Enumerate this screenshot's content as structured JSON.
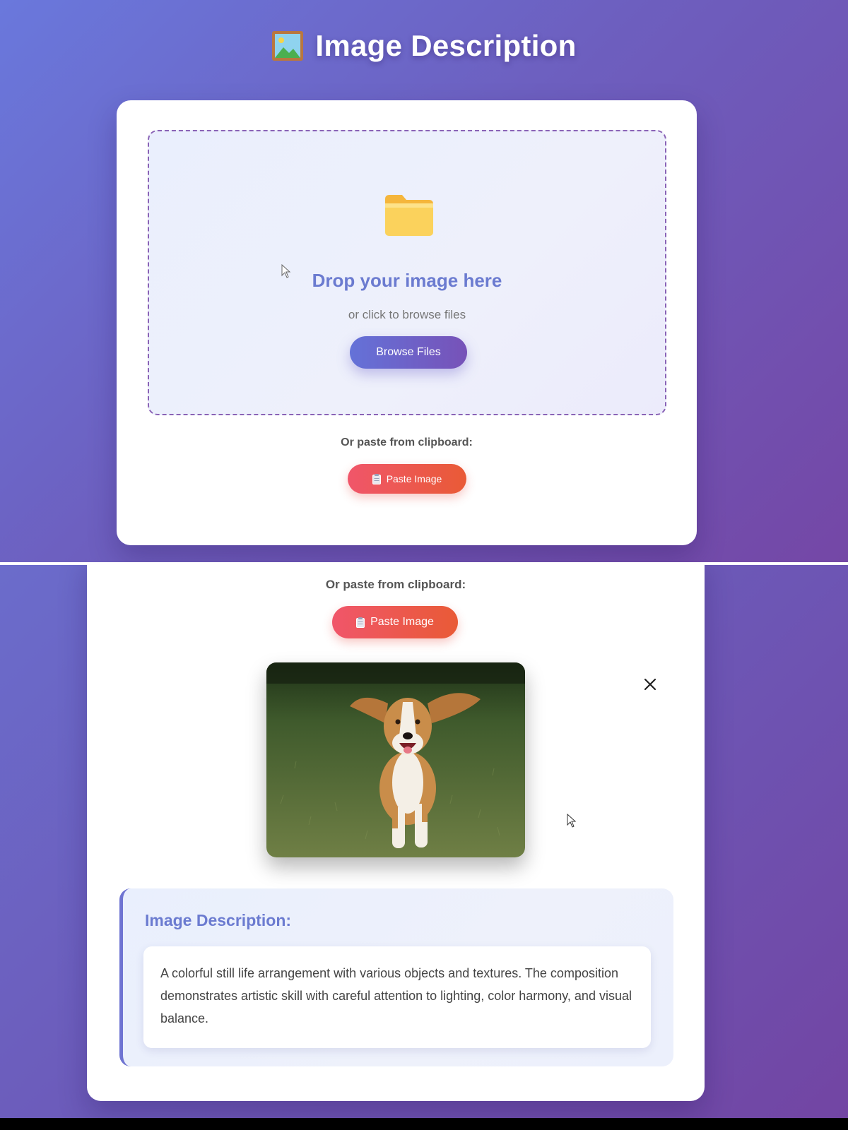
{
  "header": {
    "title": "Image Description",
    "title_icon": "framed-picture-icon"
  },
  "upload": {
    "drop_title": "Drop your image here",
    "drop_subtitle": "or click to browse files",
    "browse_label": "Browse Files",
    "folder_icon": "folder-icon",
    "paste_prompt": "Or paste from clipboard:",
    "paste_label": "Paste Image",
    "paste_icon": "clipboard-icon"
  },
  "result": {
    "paste_prompt": "Or paste from clipboard:",
    "paste_label": "Paste Image",
    "remove_icon": "close-icon",
    "preview_subject": "dog running on grass",
    "description_title": "Image Description:",
    "description_text": "A colorful still life arrangement with various objects and textures. The composition demonstrates artistic skill with careful attention to lighting, color harmony, and visual balance."
  },
  "colors": {
    "background_start": "#6a78dc",
    "background_end": "#7447a6",
    "accent": "#6b7bd0",
    "browse_button_start": "#6472d8",
    "browse_button_end": "#7752b8",
    "paste_button_start": "#f0566a",
    "paste_button_end": "#e95a36",
    "dropzone_border": "#8a63b6"
  }
}
